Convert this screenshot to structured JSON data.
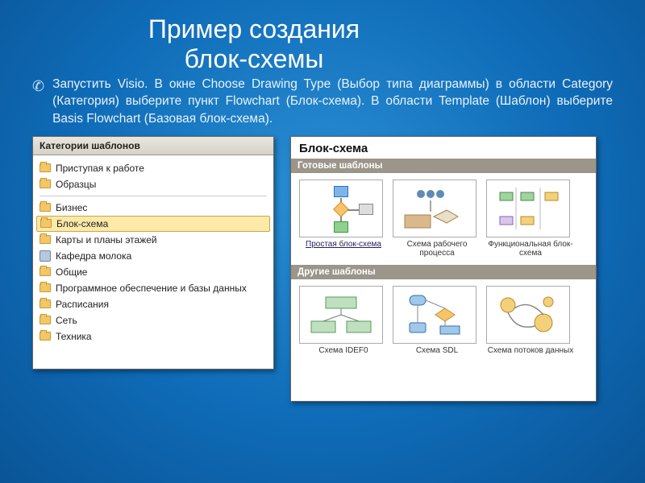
{
  "title_line1": "Пример создания",
  "title_line2": "блок-схемы",
  "body_text": "Запустить Visio. В окне Choose Drawing Type (Выбор типа диаграммы) в области Category (Категория) выберите пункт Flowchart (Блок-схема). В области Template (Шаблон) выберите Basis Flowchart (Базовая блок-схема).",
  "left_panel": {
    "header": "Категории шаблонов",
    "top_items": [
      "Приступая к работе",
      "Образцы"
    ],
    "items": [
      {
        "label": "Бизнес",
        "icon": "folder"
      },
      {
        "label": "Блок-схема",
        "icon": "folder",
        "selected": true
      },
      {
        "label": "Карты и планы этажей",
        "icon": "folder"
      },
      {
        "label": "Кафедра молока",
        "icon": "generic"
      },
      {
        "label": "Общие",
        "icon": "folder"
      },
      {
        "label": "Программное обеспечение и базы данных",
        "icon": "folder"
      },
      {
        "label": "Расписания",
        "icon": "folder"
      },
      {
        "label": "Сеть",
        "icon": "folder"
      },
      {
        "label": "Техника",
        "icon": "folder"
      }
    ]
  },
  "right_panel": {
    "title": "Блок-схема",
    "section1": "Готовые шаблоны",
    "templates1": [
      {
        "label": "Простая блок-схема",
        "underline": true
      },
      {
        "label": "Схема рабочего процесса"
      },
      {
        "label": "Функциональная блок-схема"
      }
    ],
    "section2": "Другие шаблоны",
    "templates2": [
      {
        "label": "Схема IDEF0"
      },
      {
        "label": "Схема SDL"
      },
      {
        "label": "Схема потоков данных"
      }
    ]
  }
}
